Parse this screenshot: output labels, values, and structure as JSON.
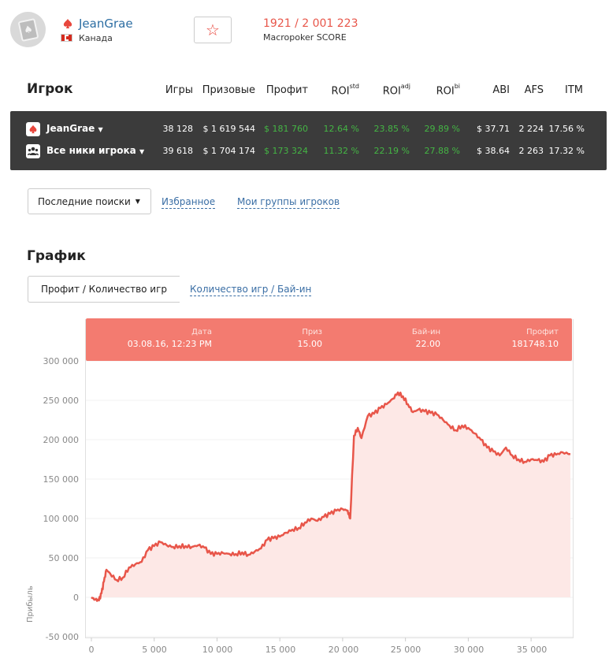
{
  "player": {
    "name": "JeanGrae",
    "country": "Канада",
    "score": "1921 / 2 001 223",
    "score_label": "Macropoker SCORE"
  },
  "stats": {
    "title": "Игрок",
    "columns": {
      "games": "Игры",
      "prizes": "Призовые",
      "profit": "Профит",
      "roi": "ROI",
      "roi_std_sup": "std",
      "roi_adj_sup": "adj",
      "roi_bi_sup": "bi",
      "abi": "ABI",
      "afs": "AFS",
      "itm": "ITM"
    },
    "rows": [
      {
        "name": "JeanGrae",
        "icon": "pokerstars-spade-icon",
        "games": "38 128",
        "prizes": "$ 1 619 544",
        "profit": "$ 181 760",
        "roi_std": "12.64 %",
        "roi_adj": "23.85 %",
        "roi_bi": "29.89 %",
        "abi": "$ 37.71",
        "afs": "2 224",
        "itm": "17.56 %"
      },
      {
        "name": "Все ники игрока",
        "icon": "all-nicks-group-icon",
        "games": "39 618",
        "prizes": "$ 1 704 174",
        "profit": "$ 173 324",
        "roi_std": "11.32 %",
        "roi_adj": "22.19 %",
        "roi_bi": "27.88 %",
        "abi": "$ 38.64",
        "afs": "2 263",
        "itm": "17.32 %"
      }
    ]
  },
  "filters": {
    "recent_searches": "Последние поиски",
    "favorites": "Избранное",
    "my_groups": "Мои группы игроков"
  },
  "graph": {
    "title": "График",
    "tab_active": "Профит / Количество игр",
    "tab_other": "Количество игр / Бай-ин",
    "tooltip": {
      "date_label": "Дата",
      "date_value": "03.08.16, 12:23 PM",
      "prize_label": "Приз",
      "prize_value": "15.00",
      "buyin_label": "Бай-ин",
      "buyin_value": "22.00",
      "profit_label": "Профит",
      "profit_value": "181748.10"
    }
  },
  "chart_data": {
    "type": "area",
    "ylabel": "Прибыль",
    "xlim": [
      0,
      38128
    ],
    "ylim": [
      -50000,
      300000
    ],
    "y_ticks": [
      "300 000",
      "250 000",
      "200 000",
      "150 000",
      "100 000",
      "50 000",
      "0",
      "-50 000"
    ],
    "x_ticks": [
      "0",
      "5 000",
      "10 000",
      "15 000",
      "20 000",
      "25 000",
      "30 000",
      "35 000"
    ],
    "color": "#e8564a",
    "fill_color": "#fde8e6",
    "x": [
      0,
      300,
      600,
      800,
      1000,
      1200,
      1500,
      2000,
      2500,
      3000,
      3500,
      4000,
      4500,
      5000,
      5500,
      6000,
      6500,
      7000,
      7500,
      8000,
      8500,
      9000,
      9500,
      10000,
      10500,
      11000,
      11500,
      12000,
      12500,
      13000,
      13500,
      14000,
      14500,
      15000,
      15500,
      16000,
      16500,
      17000,
      17500,
      18000,
      18500,
      19000,
      19500,
      20000,
      20400,
      20600,
      20900,
      21200,
      21500,
      22000,
      22500,
      23000,
      23500,
      24000,
      24400,
      24800,
      25200,
      25600,
      26000,
      26500,
      27000,
      27500,
      28000,
      28500,
      29000,
      29500,
      30000,
      30500,
      31000,
      31500,
      32000,
      32500,
      33000,
      33500,
      34000,
      34500,
      35000,
      35500,
      36000,
      36500,
      37000,
      37500,
      38128
    ],
    "y": [
      0,
      -3000,
      -4000,
      5000,
      20000,
      35000,
      30000,
      22000,
      25000,
      38000,
      42000,
      45000,
      60000,
      65000,
      70000,
      66000,
      64000,
      65000,
      65000,
      64000,
      66000,
      63000,
      55000,
      55000,
      56000,
      55000,
      55000,
      57000,
      54000,
      58000,
      62000,
      73000,
      75000,
      77000,
      82000,
      86000,
      88000,
      95000,
      100000,
      97000,
      102000,
      106000,
      110000,
      112000,
      110000,
      100000,
      205000,
      215000,
      202000,
      230000,
      233000,
      240000,
      245000,
      252000,
      260000,
      255000,
      245000,
      235000,
      238000,
      236000,
      234000,
      232000,
      225000,
      218000,
      212000,
      218000,
      215000,
      208000,
      200000,
      190000,
      185000,
      180000,
      190000,
      180000,
      175000,
      172000,
      175000,
      174000,
      172000,
      180000,
      181000,
      184000,
      181748
    ]
  }
}
